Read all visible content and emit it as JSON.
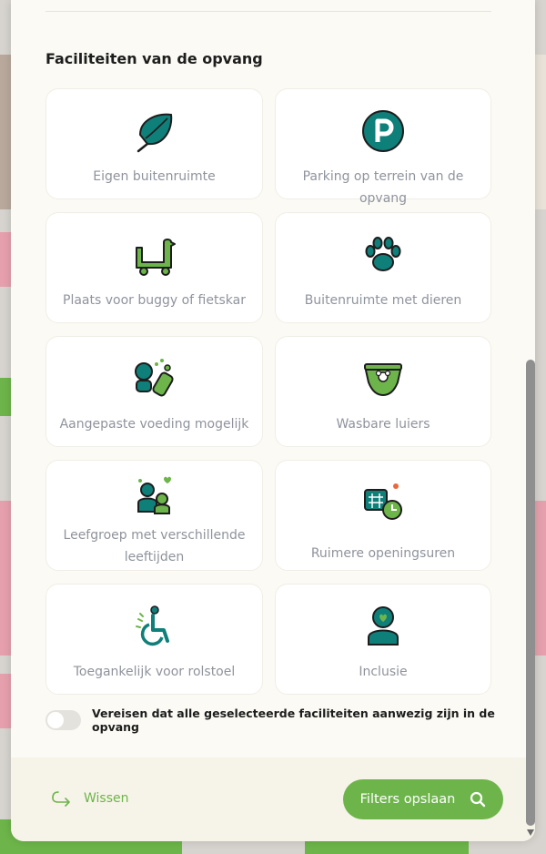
{
  "section_title": "Faciliteiten van de opvang",
  "facilities": [
    {
      "label": "Eigen buitenruimte",
      "icon": "leaf-icon"
    },
    {
      "label": "Parking op terrein van de opvang",
      "icon": "parking-icon"
    },
    {
      "label": "Plaats voor buggy of fietskar",
      "icon": "buggy-icon"
    },
    {
      "label": "Buitenruimte met dieren",
      "icon": "paw-icon"
    },
    {
      "label": "Aangepaste voeding mogelijk",
      "icon": "baby-bottle-icon"
    },
    {
      "label": "Wasbare luiers",
      "icon": "diaper-icon"
    },
    {
      "label": "Leefgroep met verschillende leeftijden",
      "icon": "mixed-age-group-icon"
    },
    {
      "label": "Ruimere openingsuren",
      "icon": "calendar-clock-icon"
    },
    {
      "label": "Toegankelijk voor rolstoel",
      "icon": "wheelchair-icon"
    },
    {
      "label": "Inclusie",
      "icon": "person-heart-icon"
    }
  ],
  "toggle": {
    "label": "Vereisen dat alle geselecteerde faciliteiten aanwezig zijn in de opvang",
    "checked": false
  },
  "footer": {
    "clear_label": "Wissen",
    "save_label": "Filters opslaan"
  },
  "colors": {
    "brand_green": "#6db54a",
    "teal": "#0f7f7a",
    "dark": "#1d1d1d",
    "muted_text": "#8f939c"
  }
}
